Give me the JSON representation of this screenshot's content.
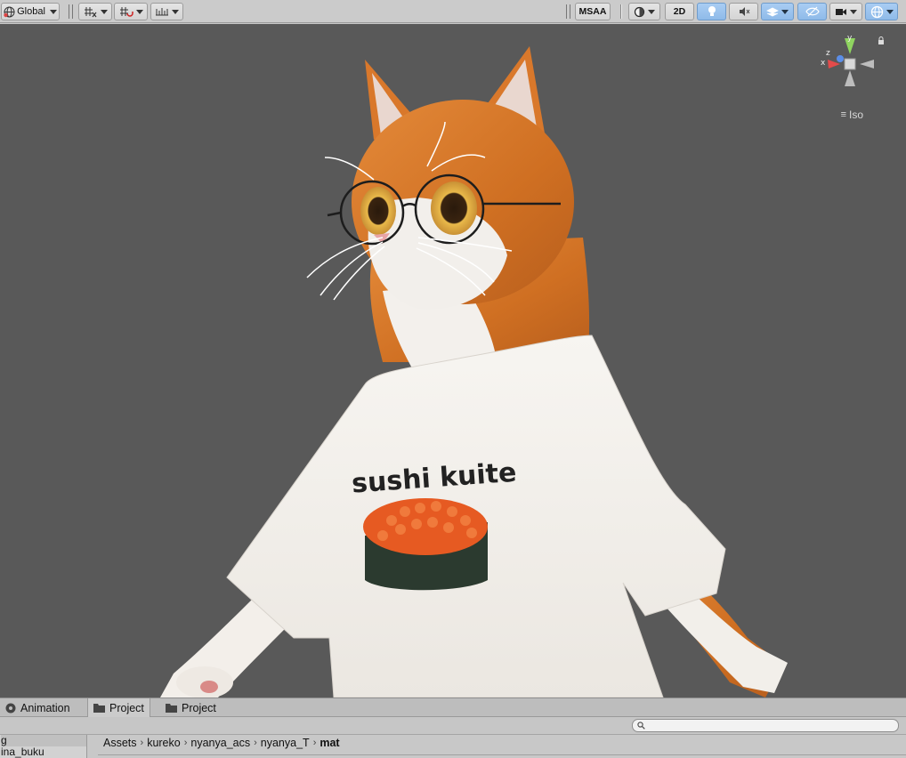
{
  "toolbar": {
    "pivot_rotation": "Global",
    "msaa": "MSAA",
    "mode_2d": "2D",
    "icons": [
      "globe-icon",
      "grid-snap-icon",
      "increment-snap-icon",
      "ruler-icon",
      "shading-mode-icon",
      "lighting-icon",
      "audio-icon",
      "effects-icon",
      "hidden-objects-icon",
      "camera-icon",
      "gizmos-icon"
    ]
  },
  "scene": {
    "projection_label": "Iso",
    "gizmo_axes": {
      "x": "x",
      "y": "y",
      "z": "z"
    },
    "shirt_text": "sushi kuite",
    "colors": {
      "background": "#595959",
      "fur": "#d97a2b",
      "shirt": "#f4f1ec",
      "ikura": "#e8541e",
      "nori": "#2c3a30"
    }
  },
  "tabs": [
    {
      "label": "Animation",
      "icon": "animation-icon"
    },
    {
      "label": "Project",
      "icon": "folder-icon"
    },
    {
      "label": "Project",
      "icon": "folder-icon"
    }
  ],
  "tree": {
    "items": [
      "g",
      "ina_buku"
    ]
  },
  "breadcrumb": [
    "Assets",
    "kureko",
    "nyanya_acs",
    "nyanya_T",
    "mat"
  ]
}
